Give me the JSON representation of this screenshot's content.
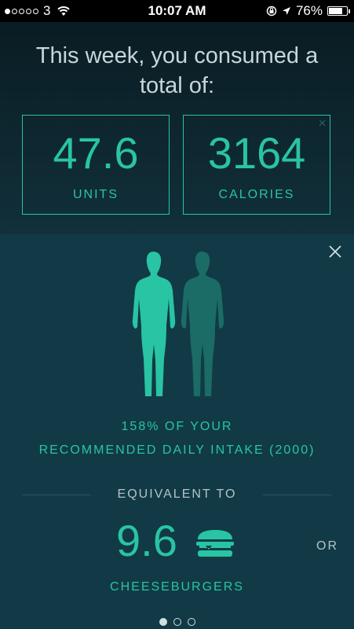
{
  "status": {
    "signal_filled": 1,
    "signal_total": 5,
    "carrier": "3",
    "time": "10:07 AM",
    "battery": "76%",
    "battery_level": 0.76
  },
  "summary": {
    "headline": "This week, you consumed a total of:",
    "units_value": "47.6",
    "units_label": "UNITS",
    "calories_value": "3164",
    "calories_label": "CALORIES"
  },
  "card": {
    "percent_line": "158% OF YOUR",
    "intake_line": "RECOMMENDED DAILY INTAKE (2000)",
    "equivalent_label": "EQUIVALENT TO",
    "equivalent_value": "9.6",
    "equivalent_item": "CHEESEBURGERS",
    "or_label": "OR",
    "fill_fraction": 0.58,
    "page_dots": 3,
    "active_dot": 0
  },
  "colors": {
    "accent": "#29c4a4",
    "background": "#0d2530",
    "card": "#113a46"
  },
  "icons": [
    "wifi-icon",
    "lock-rotation-icon",
    "location-arrow-icon",
    "battery-icon",
    "close-icon",
    "body-figure-icon",
    "cheeseburger-icon"
  ]
}
